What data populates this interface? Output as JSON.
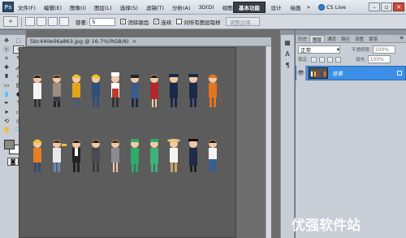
{
  "app": {
    "logo": "Ps"
  },
  "menu": [
    "文件(F)",
    "编辑(E)",
    "图像(I)",
    "图层(L)",
    "选择(S)",
    "滤镜(T)",
    "分析(A)",
    "3D(D)",
    "视图(V)"
  ],
  "menubar_zoom": "16.7",
  "workspaces": {
    "essentials": "基本功能",
    "design": "设计",
    "painting": "绘画",
    "more": "»"
  },
  "cs_live": "CS Live",
  "window_controls": {
    "minimize": "–",
    "restore": "▫",
    "close": "✕"
  },
  "options": {
    "feather_label": "容差:",
    "feather_value": "5",
    "antialias_label": "消除锯齿",
    "contiguous_label": "连续",
    "sample_all_label": "对所有图层取样",
    "refine_edge_label": "调整边缘..."
  },
  "document": {
    "tab_title": "5bc440e06a863.jpg @ 16.7%(RGB/8)",
    "tab_close": "×",
    "canvas_bg": "#5c5c5c"
  },
  "layers_panel": {
    "tabs": [
      "历史",
      "图层",
      "通道",
      "路径",
      "调整",
      "蒙版"
    ],
    "active_tab": 1,
    "blend_mode": "正常",
    "opacity_label": "不透明度:",
    "opacity_value": "100%",
    "lock_label": "锁定:",
    "fill_label": "填充:",
    "fill_value": "100%",
    "layer_name": "背景",
    "selected_color": "#3c8ee6"
  },
  "icons": [
    "marquee-icon",
    "lasso-icon",
    "magic-wand-icon",
    "crop-icon",
    "eyedropper-icon",
    "brush-icon",
    "stamp-icon",
    "eraser-icon",
    "gradient-icon",
    "dodge-icon",
    "pen-icon",
    "type-icon",
    "path-select-icon",
    "shape-icon",
    "hand-icon",
    "zoom-icon"
  ],
  "watermark": "优强软件站"
}
